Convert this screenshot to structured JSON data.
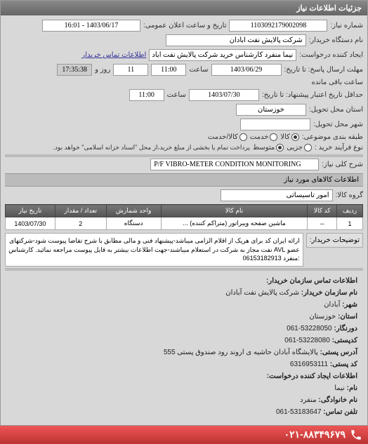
{
  "panel_title": "جزئیات اطلاعات نیاز",
  "fields": {
    "req_no_lbl": "شماره نیاز:",
    "req_no": "1103092179002098",
    "pub_date_lbl": "تاریخ و ساعت اعلان عمومی:",
    "pub_date": "1403/06/17 - 16:01",
    "buyer_org_lbl": "نام دستگاه خریدار:",
    "buyer_org": "شرکت پالایش نفت آبادان",
    "creator_lbl": "ایجاد کننده درخواست:",
    "creator": "نیما منفرد کارشناس خرید شرکت پالایش نفت آبادان",
    "contact_link": "اطلاعات تماس خریدار",
    "deadline_lbl": "مهلت ارسال پاسخ: تا تاریخ:",
    "deadline_date": "1403/06/29",
    "time_lbl": "ساعت",
    "deadline_time": "11:00",
    "remain_days": "11",
    "remain_days_lbl": "روز و",
    "remain_time": "17:35:38",
    "remain_lbl": "ساعت باقی مانده",
    "min_deadline_lbl": "حداقل تاریخ اعتبار پیشنهاد: تا تاریخ:",
    "min_deadline_date": "1403/07/30",
    "min_deadline_time": "11:00",
    "delivery_state_lbl": "استان محل تحویل:",
    "delivery_state": "خوزستان",
    "delivery_city_lbl": "شهر محل تحویل:",
    "category_lbl": "طبقه بندی موضوعی:",
    "cat_goods": "کالا",
    "cat_service": "خدمت",
    "cat_goods_service": "کالا/خدمت",
    "process_lbl": "نوع فرآیند خرید :",
    "proc_small": "جزیی",
    "proc_medium": "متوسط",
    "proc_note": "پرداخت تمام یا بخشی از مبلغ خرید،از محل \"اسناد خزانه اسلامی\" خواهد بود.",
    "subject_lbl": "شرح کلی نیاز:",
    "subject": "P/F VIBRO-METER CONDITION MONITORING",
    "items_header": "اطلاعات کالاهای مورد نیاز",
    "group_lbl": "گروه کالا:",
    "group_val": "امور تاسیساتی"
  },
  "table": {
    "headers": [
      "ردیف",
      "کد کالا",
      "نام کالا",
      "واحد شمارش",
      "تعداد / مقدار",
      "تاریخ نیاز"
    ],
    "row": [
      "1",
      "--",
      "ماشین صفحه ویبراتور (متراکم کننده) ...",
      "دستگاه",
      "2",
      "1403/07/30"
    ]
  },
  "desc": {
    "lbl": "توضیحات خریدار:",
    "val": "ارائه ایران کد برای هریک از اقلام الزامی میباشد-پیشنهاد فنی و مالی مطابق با شرح تقاضا پیوست شود-شرکتهای عضو AVL نفت مجاز به شرکت در استعلام میباشند-جهت اطلاعات بیشتر به فایل پیوست مراجعه نمائید. کارشناس :منفرد 06153182913"
  },
  "contact": {
    "header": "اطلاعات تماس سازمان خریدار:",
    "org_lbl": "نام سازمان خریدار:",
    "org": "شرکت پالایش نفت آبادان",
    "city_lbl": "شهر:",
    "city": "آبادان",
    "state_lbl": "استان:",
    "state": "خوزستان",
    "fax_lbl": "دورنگار:",
    "fax": "53228050-061",
    "postal_lbl": "کدپستی:",
    "postal": "53228080-061",
    "addr_lbl": "آدرس پستی:",
    "addr": "پالایشگاه آبادان حاشیه ی اروند رود صندوق پستی 555",
    "postcode_lbl": "کد پستی:",
    "postcode": "6316953111",
    "creator2_lbl": "اطلاعات ایجاد کننده درخواست:",
    "name_lbl": "نام:",
    "name": "نیما",
    "family_lbl": "نام خانوادگی:",
    "family": "منفرد",
    "tel_lbl": "تلفن تماس:",
    "tel": "53183647-061"
  },
  "phone": "۰۲۱-۸۸۳۴۹۶۷۹"
}
